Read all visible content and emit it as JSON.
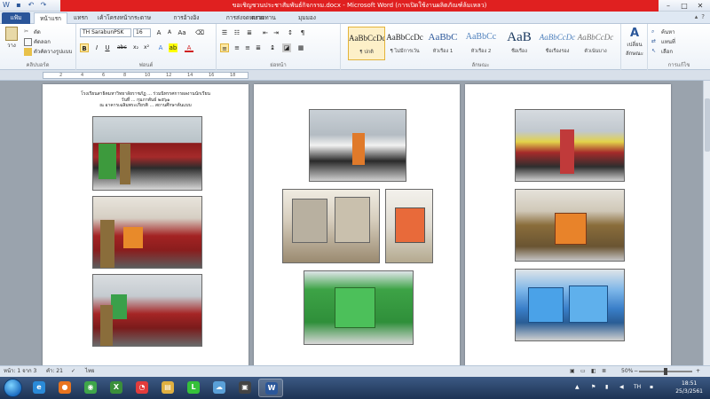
{
  "window": {
    "title": "ขอเชิญชวนประชาสัมพันธ์กิจกรรม.docx - Microsoft Word (การเปิดใช้งานผลิตภัณฑ์ล้มเหลว)",
    "controls": [
      "–",
      "□",
      "✕"
    ]
  },
  "tabs": [
    {
      "label": "แฟ้ม",
      "active": false,
      "file": true
    },
    {
      "label": "หน้าแรก",
      "active": true
    },
    {
      "label": "แทรก",
      "active": false
    },
    {
      "label": "เค้าโครงหน้ากระดาษ",
      "active": false
    },
    {
      "label": "การอ้างอิง",
      "active": false
    },
    {
      "label": "การส่งจดหมาย",
      "active": false
    },
    {
      "label": "ตรวจทาน",
      "active": false
    },
    {
      "label": "มุมมอง",
      "active": false
    }
  ],
  "ribbon": {
    "clipboard": {
      "paste_label": "วาง",
      "cut_label": "ตัด",
      "copy_label": "คัดลอก",
      "painter_label": "ตัวคัดวางรูปแบบ",
      "group_label": "คลิปบอร์ด"
    },
    "font": {
      "name": "TH SarabunPSK",
      "size": "16",
      "group_label": "ฟอนต์"
    },
    "paragraph": {
      "group_label": "ย่อหน้า"
    },
    "styles": {
      "group_label": "ลักษณะ",
      "items": [
        {
          "sample": "AaBbCcDc",
          "name": "¶ ปกติ",
          "selected": true
        },
        {
          "sample": "AaBbCcDc",
          "name": "¶ ไม่มีการเว้น",
          "selected": false
        },
        {
          "sample": "AaBbC",
          "name": "หัวเรื่อง 1",
          "selected": false
        },
        {
          "sample": "AaBbCc",
          "name": "หัวเรื่อง 2",
          "selected": false
        },
        {
          "sample": "AaB",
          "name": "ชื่อเรื่อง",
          "selected": false
        },
        {
          "sample": "AaBbCcDc",
          "name": "ชื่อเรื่องรอง",
          "selected": false
        },
        {
          "sample": "AaBbCcDc",
          "name": "ตัวเน้นบาง",
          "selected": false
        }
      ]
    },
    "change_styles_label": "เปลี่ยน ลักษณะ",
    "editing": {
      "find_label": "ค้นหา",
      "replace_label": "แทนที่",
      "select_label": "เลือก",
      "group_label": "การแก้ไข"
    }
  },
  "ruler": {
    "ticks": [
      "2",
      "4",
      "6",
      "8",
      "10",
      "12",
      "14",
      "16",
      "18"
    ]
  },
  "pages": [
    {
      "caption_lines": [
        "โรงเรียนสาธิตมหาวิทยาลัยราชภัฏ ... ร่วมนิทรรศการผลงานนักเรียน",
        "วันที่ ... กุมภาพันธ์ ๒๕๖๑",
        "ณ อาคารเฉลิมพระเกียรติ ... สถานศึกษาต้นแบบ"
      ]
    },
    {
      "caption_lines": []
    },
    {
      "caption_lines": []
    }
  ],
  "status": {
    "page": "หน้า: 1 จาก 3",
    "words": "คำ: 21",
    "language": "ไทย",
    "zoom": "50%",
    "zoom_fraction": 0.5
  },
  "taskbar": {
    "apps": [
      {
        "name": "ie",
        "glyph": "e",
        "color": "#2a8ad8"
      },
      {
        "name": "firefox",
        "glyph": "●",
        "color": "#e8741f"
      },
      {
        "name": "chrome",
        "glyph": "◉",
        "color": "#3fa64a"
      },
      {
        "name": "excel-tool",
        "glyph": "X",
        "color": "#3a8f3a"
      },
      {
        "name": "app-o",
        "glyph": "◔",
        "color": "#e23c3c"
      },
      {
        "name": "explorer",
        "glyph": "▤",
        "color": "#e0b040"
      },
      {
        "name": "line",
        "glyph": "L",
        "color": "#35c13a"
      },
      {
        "name": "network",
        "glyph": "☁",
        "color": "#5aa0d8"
      },
      {
        "name": "media",
        "glyph": "▣",
        "color": "#444"
      },
      {
        "name": "word",
        "glyph": "W",
        "color": "#2b579a"
      }
    ],
    "clock": {
      "time": "18:51",
      "date": "25/3/2561"
    },
    "lang": "TH"
  },
  "colors": {
    "title_bar": "#e02020",
    "word_blue": "#2b579a"
  }
}
